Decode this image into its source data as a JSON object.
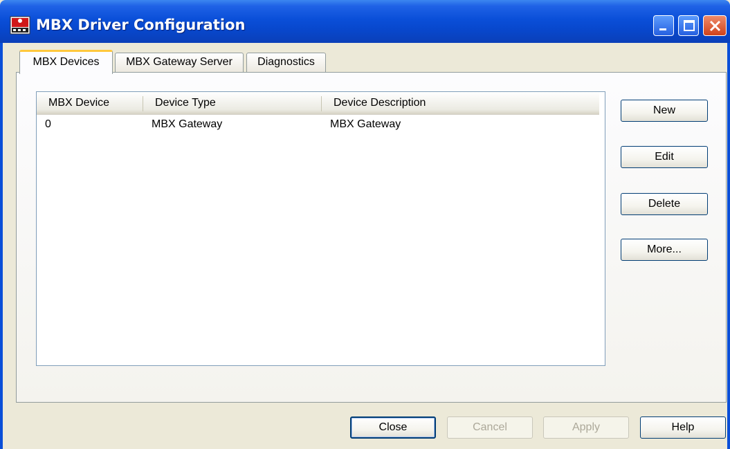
{
  "window": {
    "title": "MBX Driver Configuration",
    "app_icon": "mbx-app-icon",
    "controls": [
      "minimize-icon",
      "maximize-icon",
      "close-icon"
    ]
  },
  "tabs": [
    {
      "label": "MBX Devices",
      "active": true
    },
    {
      "label": "MBX Gateway Server",
      "active": false
    },
    {
      "label": "Diagnostics",
      "active": false
    }
  ],
  "device_list": {
    "columns": [
      "MBX Device",
      "Device Type",
      "Device Description"
    ],
    "rows": [
      {
        "device": "0",
        "type": "MBX Gateway",
        "description": "MBX Gateway"
      }
    ]
  },
  "side_buttons": {
    "new": "New",
    "edit": "Edit",
    "delete": "Delete",
    "more": "More..."
  },
  "footer_buttons": {
    "close": "Close",
    "cancel": "Cancel",
    "apply": "Apply",
    "help": "Help"
  },
  "colors": {
    "titlebar": "#0a4fd8",
    "active_tab_accent": "#ffc83c",
    "close_button": "#d0421b",
    "dialog_bg": "#ece9d8"
  }
}
